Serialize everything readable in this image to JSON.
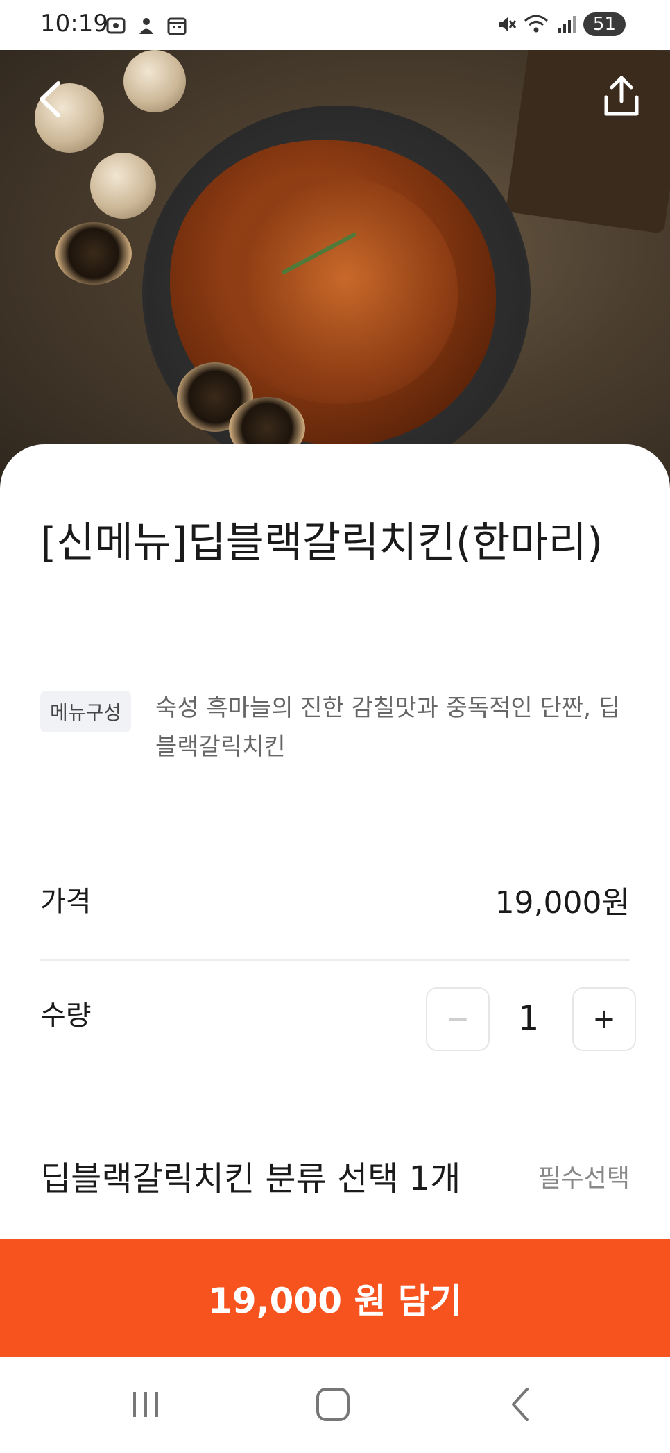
{
  "status": {
    "time": "10:19",
    "battery": "51"
  },
  "product": {
    "title": "[신메뉴]딥블랙갈릭치킨(한마리)",
    "badge": "메뉴구성",
    "description": "숙성 흑마늘의 진한 감칠맛과 중독적인 단짠, 딥블랙갈릭치킨"
  },
  "price": {
    "label": "가격",
    "value": "19,000원"
  },
  "quantity": {
    "label": "수량",
    "value": "1",
    "minus": "−",
    "plus": "+"
  },
  "option": {
    "title": "딥블랙갈릭치킨 분류 선택 1개",
    "required": "필수선택"
  },
  "cta": {
    "label": "19,000 원 담기"
  },
  "colors": {
    "accent": "#f7531f",
    "badge_bg": "#f1f2f6"
  },
  "icons": [
    "back-icon",
    "share-icon",
    "recent-apps-icon",
    "home-icon",
    "nav-back-icon"
  ]
}
